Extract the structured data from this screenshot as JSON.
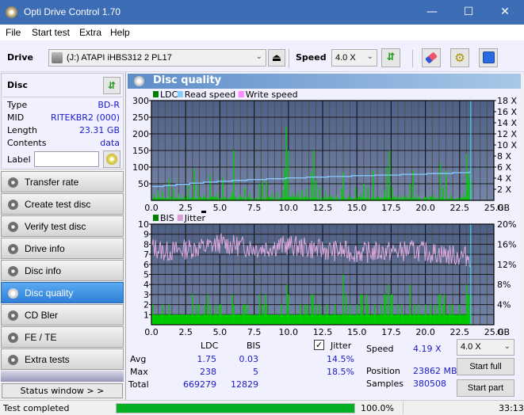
{
  "window": {
    "title": "Opti Drive Control 1.70",
    "minimize": "—",
    "maximize": "☐",
    "close": "✕"
  },
  "menu": [
    "File",
    "Start test",
    "Extra",
    "Help"
  ],
  "toolbar": {
    "drive_label": "Drive",
    "drive_value": "(J:)  ATAPI iHBS312  2 PL17",
    "speed_label": "Speed",
    "speed_value": "4.0 X",
    "icons": [
      "eject-icon",
      "refresh-icon",
      "eraser-icon",
      "settings-icon",
      "save-icon"
    ]
  },
  "disc": {
    "title": "Disc",
    "rows": [
      {
        "key": "Type",
        "value": "BD-R"
      },
      {
        "key": "MID",
        "value": "RITEKBR2 (000)"
      },
      {
        "key": "Length",
        "value": "23.31 GB"
      },
      {
        "key": "Contents",
        "value": "data"
      }
    ],
    "label_key": "Label",
    "label_value": ""
  },
  "nav": [
    {
      "label": "Transfer rate",
      "active": false
    },
    {
      "label": "Create test disc",
      "active": false
    },
    {
      "label": "Verify test disc",
      "active": false
    },
    {
      "label": "Drive info",
      "active": false
    },
    {
      "label": "Disc info",
      "active": false
    },
    {
      "label": "Disc quality",
      "active": true
    },
    {
      "label": "CD Bler",
      "active": false
    },
    {
      "label": "FE / TE",
      "active": false
    },
    {
      "label": "Extra tests",
      "active": false
    }
  ],
  "status_window_label": "Status window > >",
  "panel_title": "Disc quality",
  "chart_data": [
    {
      "type": "bar",
      "title": "",
      "legend": [
        "LDC",
        "Read speed",
        "Write speed"
      ],
      "legend_colors": [
        "#008000",
        "#88ccff",
        "#ff88ff"
      ],
      "legend_placement": "top-left",
      "xlabel": "GB",
      "ylim": [
        0,
        300
      ],
      "y_ticks": [
        50,
        100,
        150,
        200,
        250,
        300
      ],
      "y2_ticks": [
        "2 X",
        "4 X",
        "6 X",
        "8 X",
        "10 X",
        "12 X",
        "14 X",
        "16 X",
        "18 X"
      ],
      "y2lim": [
        0,
        18
      ],
      "xlim": [
        0,
        25
      ],
      "x_ticks": [
        "0.0",
        "2.5",
        "5.0",
        "7.5",
        "10.0",
        "12.5",
        "15.0",
        "17.5",
        "20.0",
        "22.5",
        "25.0"
      ],
      "end_position_gb": 23.31,
      "series": [
        {
          "name": "LDC spikes",
          "x": [
            0.2,
            0.5,
            0.8,
            1.3,
            1.6,
            2.0,
            2.4,
            2.7,
            3.1,
            3.4,
            3.8,
            4.3,
            4.8,
            5.2,
            5.9,
            6.0,
            6.5,
            6.8,
            7.2,
            7.9,
            8.1,
            8.4,
            8.8,
            9.2,
            9.6,
            9.75,
            9.85,
            10.0,
            10.3,
            10.7,
            11.0,
            11.3,
            11.7,
            11.85,
            12.0,
            12.3,
            12.7,
            13.1,
            13.5,
            13.9,
            14.0,
            14.4,
            14.9,
            15.3,
            15.5,
            15.8,
            16.2,
            16.8,
            17.0,
            17.2,
            17.4,
            17.6,
            18.2,
            18.6,
            18.9,
            19.1,
            19.5,
            20.0,
            20.6,
            21.1,
            21.3,
            21.5,
            21.9,
            22.4,
            22.8,
            23.0,
            23.1,
            23.2,
            23.3
          ],
          "values": [
            20,
            30,
            25,
            65,
            35,
            20,
            15,
            45,
            95,
            45,
            15,
            78,
            20,
            70,
            25,
            150,
            15,
            40,
            20,
            50,
            60,
            55,
            20,
            25,
            30,
            95,
            220,
            150,
            20,
            25,
            30,
            35,
            85,
            150,
            60,
            40,
            25,
            15,
            15,
            35,
            85,
            15,
            40,
            20,
            50,
            40,
            90,
            10,
            30,
            100,
            150,
            40,
            15,
            15,
            50,
            90,
            15,
            10,
            15,
            110,
            40,
            90,
            15,
            10,
            20,
            140,
            85,
            60,
            100
          ]
        },
        {
          "name": "Read speed",
          "unit": "X",
          "x": [
            0,
            0.9,
            1.8,
            2.8,
            3.8,
            4.8,
            5.9,
            7.0,
            8.4,
            9.8,
            11.3,
            12.9,
            14.6,
            16.3,
            18.2,
            20.1,
            22.0,
            23.2,
            23.31
          ],
          "values": [
            2.5,
            2.7,
            2.9,
            3.1,
            3.3,
            3.45,
            3.6,
            3.75,
            3.9,
            4.05,
            4.2,
            4.3,
            4.45,
            4.55,
            4.7,
            4.85,
            5.0,
            5.1,
            5.2
          ]
        }
      ]
    },
    {
      "type": "bar",
      "title": "",
      "legend": [
        "BIS",
        "Jitter"
      ],
      "legend_colors": [
        "#008000",
        "#d8a0d8"
      ],
      "legend_placement": "top-left",
      "xlabel": "GB",
      "ylim": [
        0,
        10
      ],
      "y_ticks": [
        1,
        2,
        3,
        4,
        5,
        6,
        7,
        8,
        9,
        10
      ],
      "y2_ticks": [
        "4%",
        "8%",
        "12%",
        "16%",
        "20%"
      ],
      "y2lim": [
        0,
        20
      ],
      "xlim": [
        0,
        25
      ],
      "x_ticks": [
        "0.0",
        "2.5",
        "5.0",
        "7.5",
        "10.0",
        "12.5",
        "15.0",
        "17.5",
        "20.0",
        "22.5",
        "25.0"
      ],
      "end_position_gb": 23.31,
      "series": [
        {
          "name": "BIS spikes",
          "x": [
            0.1,
            0.8,
            1.3,
            3.0,
            3.3,
            3.5,
            3.9,
            4.1,
            4.3,
            4.7,
            5.0,
            5.1,
            5.9,
            6.0,
            6.7,
            6.8,
            7.0,
            7.9,
            8.1,
            8.3,
            8.4,
            9.5,
            9.9,
            10.0,
            10.9,
            11.2,
            11.4,
            11.7,
            11.8,
            12.0,
            12.3,
            12.8,
            13.4,
            14.0,
            14.2,
            14.5,
            15.0,
            15.3,
            15.4,
            15.7,
            15.8,
            16.3,
            16.8,
            17.0,
            17.1,
            17.3,
            17.5,
            17.6,
            18.0,
            18.3,
            18.9,
            19.2,
            19.5,
            20.0,
            20.4,
            20.7,
            21.0,
            21.1,
            21.3,
            21.4,
            21.8,
            22.0,
            22.5,
            23.0,
            23.1,
            23.2
          ],
          "values": [
            2,
            2,
            2,
            3,
            2,
            2,
            2,
            3,
            2,
            2,
            2,
            2,
            3,
            2,
            2,
            2,
            2,
            3,
            2,
            3,
            2,
            2,
            4,
            3,
            2,
            2,
            2,
            3,
            3,
            2,
            2,
            2,
            2,
            5,
            3,
            2,
            2,
            3,
            3,
            3,
            2,
            2,
            2,
            3,
            3,
            4,
            3,
            3,
            2,
            2,
            4,
            2,
            2,
            2,
            2,
            2,
            3,
            3,
            2,
            3,
            2,
            2,
            2,
            4,
            3,
            3
          ]
        },
        {
          "name": "Jitter",
          "unit": "%",
          "x": [
            0.0,
            1.0,
            2.0,
            3.0,
            4.0,
            5.0,
            6.0,
            7.0,
            8.0,
            9.0,
            10.0,
            11.0,
            12.0,
            13.0,
            14.0,
            15.0,
            16.0,
            17.0,
            18.0,
            19.0,
            20.0,
            21.0,
            22.0,
            23.0,
            23.31
          ],
          "values": [
            15.5,
            14.5,
            14.8,
            15.2,
            15.4,
            16.2,
            15.8,
            15.5,
            15.2,
            15.6,
            15.8,
            15.4,
            15.0,
            14.8,
            14.6,
            14.4,
            14.4,
            14.6,
            14.5,
            14.8,
            14.5,
            14.2,
            13.8,
            13.6,
            13.4
          ]
        }
      ]
    }
  ],
  "stats": {
    "headers": [
      "LDC",
      "BIS"
    ],
    "rows": [
      {
        "label": "Avg",
        "ldc": "1.75",
        "bis": "0.03",
        "jitter": "14.5%"
      },
      {
        "label": "Max",
        "ldc": "238",
        "bis": "5",
        "jitter": "18.5%"
      },
      {
        "label": "Total",
        "ldc": "669279",
        "bis": "12829",
        "jitter": ""
      }
    ],
    "jitter_label": "Jitter",
    "jitter_checked": true,
    "speed_label": "Speed",
    "speed_value": "4.19 X",
    "position_label": "Position",
    "position_value": "23862 MB",
    "samples_label": "Samples",
    "samples_value": "380508",
    "speed_select": "4.0 X",
    "start_full": "Start full",
    "start_part": "Start part"
  },
  "status": {
    "text": "Test completed",
    "progress_percent": 100.0,
    "progress_label": "100.0%",
    "time": "33:13"
  }
}
